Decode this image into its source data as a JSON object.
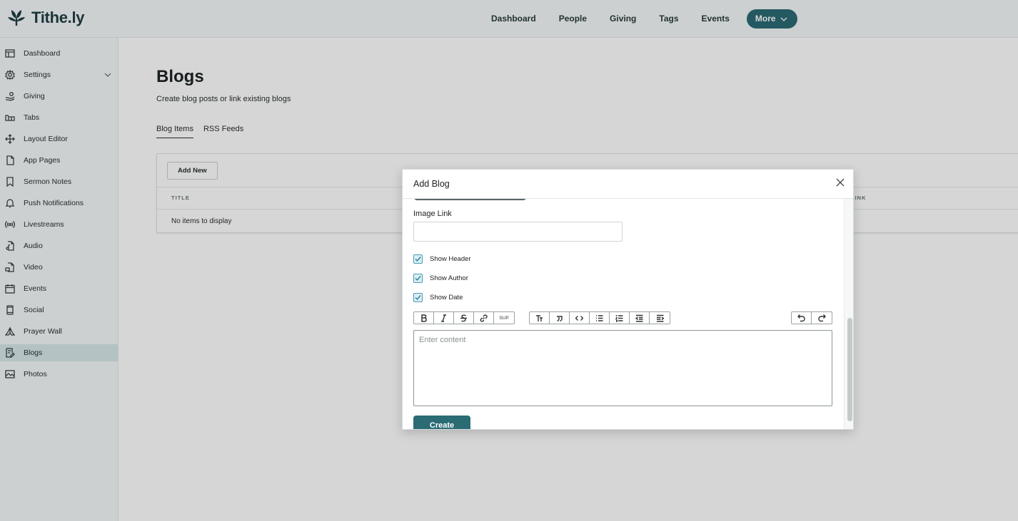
{
  "brand": {
    "name": "Tithe.ly",
    "color": "#1f3e44",
    "accent": "#2b6b74"
  },
  "topnav": {
    "items": [
      "Dashboard",
      "People",
      "Giving",
      "Tags",
      "Events"
    ],
    "more_label": "More"
  },
  "sidebar": {
    "items": [
      {
        "label": "Dashboard",
        "icon": "dashboard-icon"
      },
      {
        "label": "Settings",
        "icon": "gear-icon",
        "expandable": true
      },
      {
        "label": "Giving",
        "icon": "hand-coin-icon"
      },
      {
        "label": "Tabs",
        "icon": "tabs-icon"
      },
      {
        "label": "Layout Editor",
        "icon": "move-icon"
      },
      {
        "label": "App Pages",
        "icon": "page-icon"
      },
      {
        "label": "Sermon Notes",
        "icon": "bookmark-icon"
      },
      {
        "label": "Push Notifications",
        "icon": "bell-icon"
      },
      {
        "label": "Livestreams",
        "icon": "broadcast-icon"
      },
      {
        "label": "Audio",
        "icon": "audio-file-icon"
      },
      {
        "label": "Video",
        "icon": "video-file-icon"
      },
      {
        "label": "Events",
        "icon": "calendar-icon"
      },
      {
        "label": "Social",
        "icon": "phone-icon"
      },
      {
        "label": "Prayer Wall",
        "icon": "praying-hands-icon"
      },
      {
        "label": "Blogs",
        "icon": "blog-icon",
        "active": true
      },
      {
        "label": "Photos",
        "icon": "image-icon"
      }
    ]
  },
  "page": {
    "title": "Blogs",
    "subtitle": "Create blog posts or link existing blogs",
    "tabs": [
      {
        "label": "Blog Items",
        "active": true
      },
      {
        "label": "RSS Feeds",
        "active": false
      }
    ],
    "add_new_label": "Add New",
    "table": {
      "columns": [
        "TITLE",
        "LINK"
      ],
      "empty_text": "No items to display"
    }
  },
  "modal": {
    "title": "Add Blog",
    "image_link_label": "Image Link",
    "image_link_value": "",
    "checkboxes": [
      {
        "label": "Show Header",
        "checked": true
      },
      {
        "label": "Show Author",
        "checked": true
      },
      {
        "label": "Show Date",
        "checked": true
      }
    ],
    "toolbar_groups": [
      [
        "bold-icon",
        "italic-icon",
        "strikethrough-icon",
        "link-icon",
        "superscript-icon"
      ],
      [
        "heading-icon",
        "quote-icon",
        "code-icon",
        "bullet-list-icon",
        "numbered-list-icon",
        "outdent-icon",
        "indent-icon"
      ],
      [
        "undo-icon",
        "redo-icon"
      ]
    ],
    "superscript_label": "SUP",
    "editor_placeholder": "Enter content",
    "create_label": "Create"
  }
}
